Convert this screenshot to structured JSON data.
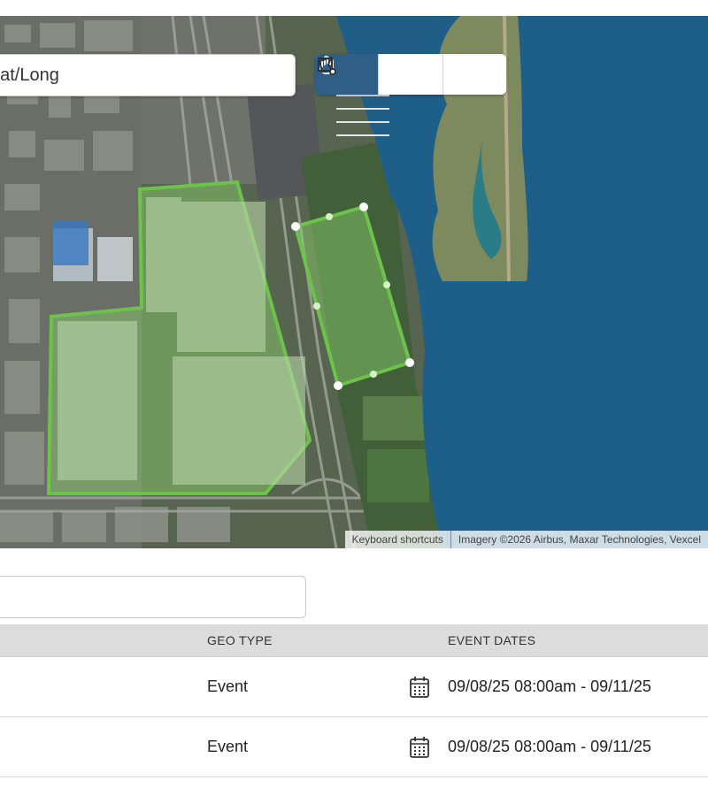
{
  "map": {
    "search_placeholder": "Lat/Long",
    "tools": [
      {
        "name": "pan-tool",
        "icon": "hand-icon",
        "active": true
      },
      {
        "name": "rectangle-tool",
        "icon": "rectangle-draw-icon",
        "active": false
      },
      {
        "name": "polygon-tool",
        "icon": "polygon-draw-icon",
        "active": false
      }
    ],
    "attribution": {
      "shortcuts": "Keyboard shortcuts",
      "imagery": "Imagery ©2026 Airbus, Maxar Technologies, Vexcel"
    },
    "colors": {
      "water": "#1e5f8a",
      "geofence_stroke": "#6cc24a",
      "geofence_fill": "rgba(140, 210, 110, 0.45)",
      "active_tool": "#2f5f87"
    }
  },
  "filter": {
    "placeholder": ""
  },
  "table": {
    "headers": {
      "geo_type": "GEO TYPE",
      "event_dates": "EVENT DATES"
    },
    "rows": [
      {
        "geo_type": "Event",
        "event_dates": "09/08/25 08:00am - 09/11/25"
      },
      {
        "geo_type": "Event",
        "event_dates": "09/08/25 08:00am - 09/11/25"
      }
    ]
  }
}
